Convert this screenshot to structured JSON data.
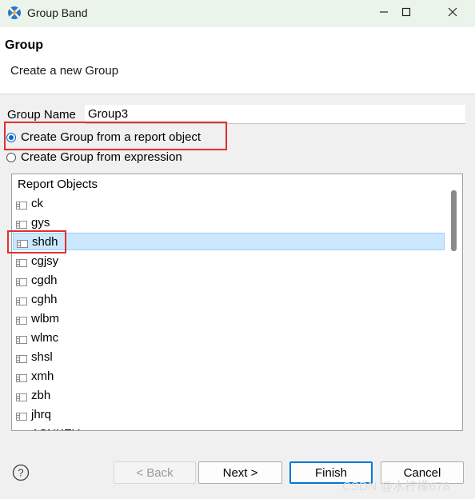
{
  "window": {
    "title": "Group Band",
    "minimize_icon": "minimize-icon",
    "maximize_icon": "maximize-icon",
    "close_icon": "close-icon",
    "app_icon": "eclipse-birt-icon"
  },
  "header": {
    "title": "Group",
    "subtitle": "Create a new Group"
  },
  "form": {
    "group_name_label": "Group Name",
    "group_name_value": "Group3",
    "radio_report_object": "Create Group from a report object",
    "radio_expression": "Create Group from expression",
    "selected_mode": "report_object"
  },
  "report_objects": {
    "header": "Report Objects",
    "items": [
      {
        "label": "ck",
        "selected": false
      },
      {
        "label": "gys",
        "selected": false
      },
      {
        "label": "shdh",
        "selected": true
      },
      {
        "label": "cgjsy",
        "selected": false
      },
      {
        "label": "cgdh",
        "selected": false
      },
      {
        "label": "cghh",
        "selected": false
      },
      {
        "label": "wlbm",
        "selected": false
      },
      {
        "label": "wlmc",
        "selected": false
      },
      {
        "label": "shsl",
        "selected": false
      },
      {
        "label": "xmh",
        "selected": false
      },
      {
        "label": "zbh",
        "selected": false
      },
      {
        "label": "jhrq",
        "selected": false
      },
      {
        "label": "ASNKEY",
        "selected": false
      }
    ]
  },
  "footer": {
    "back": "< Back",
    "next": "Next >",
    "finish": "Finish",
    "cancel": "Cancel",
    "help_icon": "help-icon"
  },
  "watermark": "CSDN @水柠檬678",
  "colors": {
    "titlebar_bg": "#eaf4ea",
    "selection_bg": "#cce8ff",
    "highlight_red": "#e0302f",
    "radio_blue": "#0a64c8"
  }
}
